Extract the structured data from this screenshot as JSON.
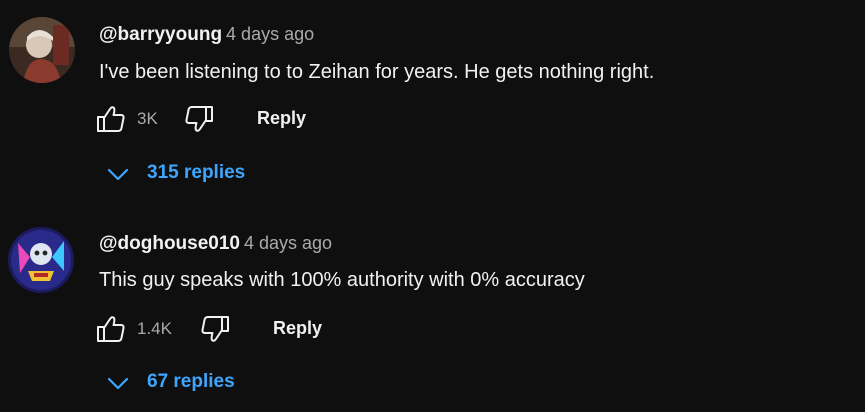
{
  "comments": [
    {
      "handle": "@barryyoung",
      "time": "4 days ago",
      "text": "I've been listening to to Zeihan for years. He gets nothing right.",
      "likes": "3K",
      "reply_label": "Reply",
      "replies_label": "315 replies",
      "avatar_icon": "user-photo-avatar"
    },
    {
      "handle": "@doghouse010",
      "time": "4 days ago",
      "text": "This guy speaks with 100% authority with 0% accuracy",
      "likes": "1.4K",
      "reply_label": "Reply",
      "replies_label": "67 replies",
      "avatar_icon": "illustrated-avatar"
    }
  ],
  "colors": {
    "background": "#0f0f0f",
    "text": "#f1f1f1",
    "secondary_text": "#aaaaaa",
    "link": "#3ea6ff"
  },
  "icons": [
    "thumbs-up-icon",
    "thumbs-down-icon",
    "chevron-down-icon"
  ]
}
